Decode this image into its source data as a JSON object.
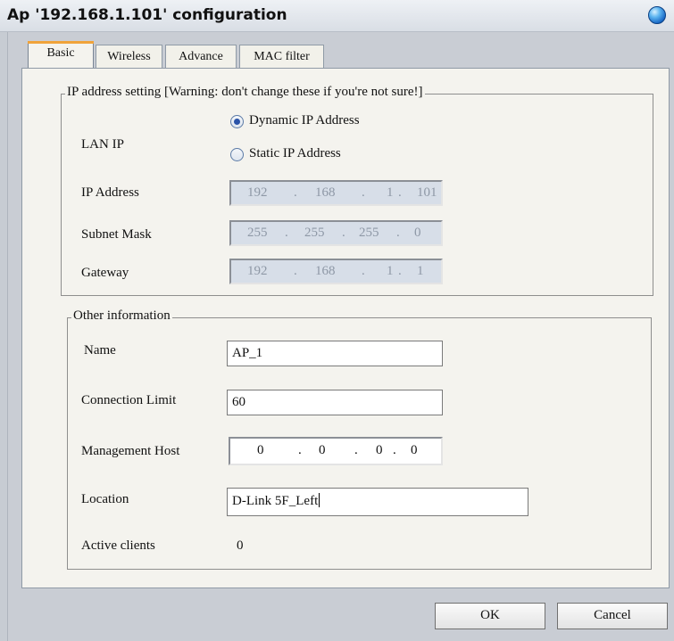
{
  "window": {
    "title": "Ap '192.168.1.101' configuration",
    "icon": "globe-orb-icon"
  },
  "tabs": [
    {
      "label": "Basic",
      "active": true
    },
    {
      "label": "Wireless",
      "active": false
    },
    {
      "label": "Advance",
      "active": false
    },
    {
      "label": "MAC filter",
      "active": false
    }
  ],
  "ip_group": {
    "legend": "IP address setting [Warning: don't change these if you're not sure!]",
    "lan_ip_label": "LAN IP",
    "radio_dynamic": "Dynamic IP Address",
    "radio_static": "Static IP Address",
    "selected_mode": "Dynamic IP Address",
    "ip_label": "IP Address",
    "ip_value": [
      "192",
      "168",
      "1",
      "101"
    ],
    "subnet_label": "Subnet Mask",
    "subnet_value": [
      "255",
      "255",
      "255",
      "0"
    ],
    "gateway_label": "Gateway",
    "gateway_value": [
      "192",
      "168",
      "1",
      "1"
    ]
  },
  "other_group": {
    "legend": "Other information",
    "name_label": "Name",
    "name_value": "AP_1",
    "conn_label": "Connection Limit",
    "conn_value": "60",
    "mgmt_label": "Management Host",
    "mgmt_value": [
      "0",
      "0",
      "0",
      "0"
    ],
    "location_label": "Location",
    "location_value": "D-Link 5F_Left",
    "clients_label": "Active clients",
    "clients_value": "0"
  },
  "buttons": {
    "ok": "OK",
    "cancel": "Cancel"
  },
  "ip_separator": "."
}
